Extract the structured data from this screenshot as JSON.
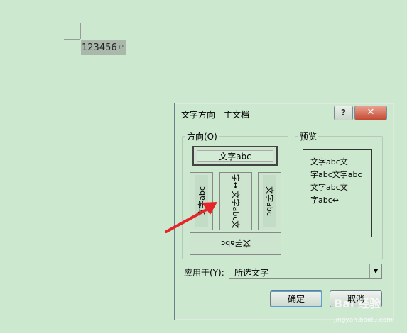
{
  "document": {
    "text": "123456",
    "para_mark": "↵"
  },
  "dialog": {
    "title": "文字方向 - 主文档",
    "help_label": "?",
    "close_label": "✕",
    "direction_group_label": "方向(O)",
    "preview_group_label": "预览",
    "options": [
      {
        "label": "文字abc",
        "selected": true
      },
      {
        "label": "文字abc"
      },
      {
        "label": "字↔ 文字abc文"
      },
      {
        "label": "文字abc"
      },
      {
        "label": "文字abc"
      }
    ],
    "preview_lines": [
      "文字abc文",
      "字abc文字abc",
      "文字abc文",
      "字abc↔"
    ],
    "apply_label": "应用于(Y):",
    "apply_value": "所选文字",
    "ok_label": "确定",
    "cancel_label": "取消"
  },
  "watermark": {
    "text": "Bai 经验",
    "sub": "jingyan.baidu.com"
  },
  "colors": {
    "background": "#cce8cf",
    "arrow": "#e4262a",
    "close_button": "#c44a32"
  }
}
